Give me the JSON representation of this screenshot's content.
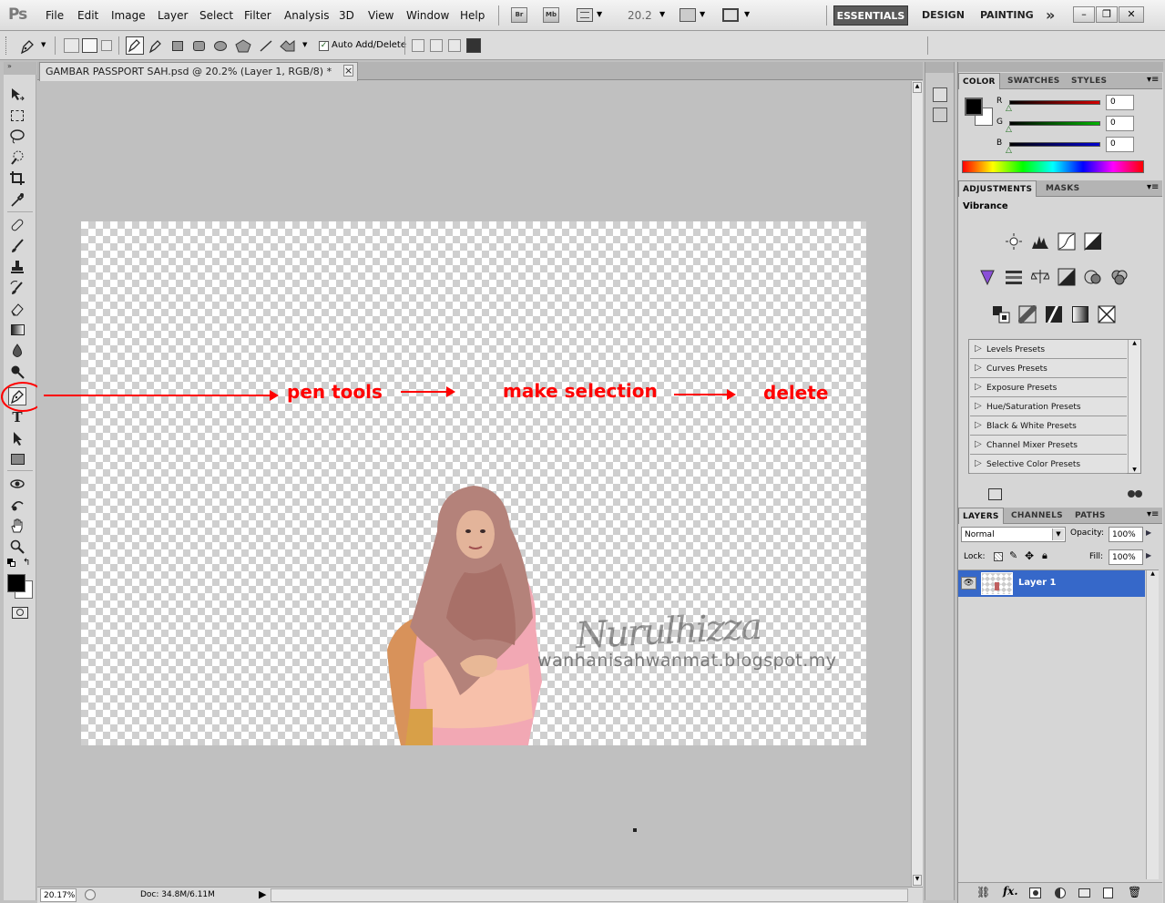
{
  "app": {
    "logo": "Ps"
  },
  "menu": [
    "File",
    "Edit",
    "Image",
    "Layer",
    "Select",
    "Filter",
    "Analysis",
    "3D",
    "View",
    "Window",
    "Help"
  ],
  "menubar_buttons": {
    "bridge": "Br",
    "mini_bridge": "Mb",
    "zoom": "20.2"
  },
  "workspaces": {
    "active": "ESSENTIALS",
    "design": "DESIGN",
    "painting": "PAINTING"
  },
  "options": {
    "auto_add_delete": "Auto Add/Delete"
  },
  "document": {
    "tab_title": "GAMBAR PASSPORT SAH.psd @ 20.2% (Layer 1, RGB/8) *",
    "tab_close": "×"
  },
  "annotations": {
    "step1": "pen tools",
    "step2": "make selection",
    "step3": "delete"
  },
  "watermark": {
    "signature": "Nurulhizza",
    "url": "wanhanisahwanmat.blogspot.my"
  },
  "status": {
    "zoom": "20.17%",
    "doc": "Doc: 34.8M/6.11M"
  },
  "color_panel": {
    "tabs": [
      "COLOR",
      "SWATCHES",
      "STYLES"
    ],
    "channels": [
      {
        "label": "R",
        "value": "0"
      },
      {
        "label": "G",
        "value": "0"
      },
      {
        "label": "B",
        "value": "0"
      }
    ],
    "colors": {
      "r": "#d40000",
      "g": "#00b400",
      "b": "#0000d0",
      "foreground": "#000000",
      "background": "#ffffff"
    }
  },
  "adjustments_panel": {
    "tabs": [
      "ADJUSTMENTS",
      "MASKS"
    ],
    "title": "Vibrance",
    "presets": [
      "Levels Presets",
      "Curves Presets",
      "Exposure Presets",
      "Hue/Saturation Presets",
      "Black & White Presets",
      "Channel Mixer Presets",
      "Selective Color Presets"
    ]
  },
  "layers_panel": {
    "tabs": [
      "LAYERS",
      "CHANNELS",
      "PATHS"
    ],
    "blend_mode": "Normal",
    "opacity_label": "Opacity:",
    "opacity": "100%",
    "lock_label": "Lock:",
    "fill_label": "Fill:",
    "fill": "100%",
    "layers": [
      {
        "name": "Layer 1",
        "selected": true
      }
    ],
    "footer_fx": "fx."
  }
}
